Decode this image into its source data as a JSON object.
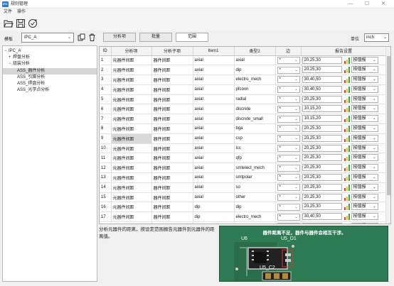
{
  "window": {
    "title": "规则管理",
    "app_icon": "app-icon"
  },
  "menu": [
    "文件",
    "操作"
  ],
  "toolbar": {
    "icons": [
      "open-folder-icon",
      "save-icon",
      "refresh-check-icon"
    ]
  },
  "template": {
    "label": "模板",
    "value": "IPC_A"
  },
  "tree": [
    {
      "label": "IPC_A",
      "toggle": "−",
      "level": 0
    },
    {
      "label": "焊盘分析",
      "toggle": "+",
      "level": 1
    },
    {
      "label": "组装分析",
      "toggle": "−",
      "level": 1
    },
    {
      "label": "ASS_器件分析",
      "toggle": "",
      "level": 2,
      "selected": true
    },
    {
      "label": "ASS_引脚分析",
      "toggle": "",
      "level": 2
    },
    {
      "label": "ASS_焊盘分析",
      "toggle": "",
      "level": 2
    },
    {
      "label": "ASS_光学点分析",
      "toggle": "",
      "level": 2
    }
  ],
  "tabs": [
    "分析项",
    "批量",
    "范围"
  ],
  "unit": {
    "label": "单位",
    "value": "inch"
  },
  "columns": [
    "ID",
    "分析项",
    "分析子项",
    "Item1",
    "类型2",
    "边",
    "报告设置"
  ],
  "rows": [
    {
      "id": "1",
      "item": "元器件间距",
      "sub": "器件间距",
      "item1": "axial",
      "type2": "axial",
      "side": "*",
      "report": "20,25,30",
      "mode": "按值报"
    },
    {
      "id": "2",
      "item": "元器件间距",
      "sub": "器件间距",
      "item1": "axial",
      "type2": "dip",
      "side": "*",
      "report": "20,25,30",
      "mode": "按值报"
    },
    {
      "id": "3",
      "item": "元器件间距",
      "sub": "器件间距",
      "item1": "axial",
      "type2": "electro_mech",
      "side": "*",
      "report": "30,40,50",
      "mode": "按值报"
    },
    {
      "id": "4",
      "item": "元器件间距",
      "sub": "器件间距",
      "item1": "axial",
      "type2": "pfconn",
      "side": "*",
      "report": "30,40,50",
      "mode": "按值报"
    },
    {
      "id": "5",
      "item": "元器件间距",
      "sub": "器件间距",
      "item1": "axial",
      "type2": "radial",
      "side": "*",
      "report": "20,25,30",
      "mode": "按值报"
    },
    {
      "id": "6",
      "item": "元器件间距",
      "sub": "器件间距",
      "item1": "axial",
      "type2": "discrete",
      "side": "*",
      "report": "10,15,20",
      "mode": "按值报"
    },
    {
      "id": "7",
      "item": "元器件间距",
      "sub": "器件间距",
      "item1": "axial",
      "type2": "discrete_small",
      "side": "*",
      "report": "10,15,20",
      "mode": "按值报"
    },
    {
      "id": "8",
      "item": "元器件间距",
      "sub": "器件间距",
      "item1": "axial",
      "type2": "bga",
      "side": "*",
      "report": "20,25,30",
      "mode": "按值报"
    },
    {
      "id": "9",
      "item": "元器件间距",
      "sub": "器件间距",
      "item1": "axial",
      "type2": "csp",
      "side": "*",
      "report": "20,25,30",
      "mode": "按值报",
      "selected": true
    },
    {
      "id": "10",
      "item": "元器件间距",
      "sub": "器件间距",
      "item1": "axial",
      "type2": "lcc",
      "side": "*",
      "report": "20,25,30",
      "mode": "按值报"
    },
    {
      "id": "11",
      "item": "元器件间距",
      "sub": "器件间距",
      "item1": "axial",
      "type2": "qfp",
      "side": "*",
      "report": "20,25,30",
      "mode": "按值报"
    },
    {
      "id": "12",
      "item": "元器件间距",
      "sub": "器件间距",
      "item1": "axial",
      "type2": "smtelect_mech",
      "side": "*",
      "report": "20,25,30",
      "mode": "按值报"
    },
    {
      "id": "13",
      "item": "元器件间距",
      "sub": "器件间距",
      "item1": "axial",
      "type2": "smtpolar",
      "side": "*",
      "report": "20,25,30",
      "mode": "按值报"
    },
    {
      "id": "14",
      "item": "元器件间距",
      "sub": "器件间距",
      "item1": "axial",
      "type2": "so",
      "side": "*",
      "report": "20,25,30",
      "mode": "按值报"
    },
    {
      "id": "15",
      "item": "元器件间距",
      "sub": "器件间距",
      "item1": "axial",
      "type2": "other",
      "side": "*",
      "report": "20,25,30",
      "mode": "按值报"
    },
    {
      "id": "16",
      "item": "元器件间距",
      "sub": "器件间距",
      "item1": "dip",
      "type2": "dip",
      "side": "*",
      "report": "20,25,30",
      "mode": "按值报"
    },
    {
      "id": "17",
      "item": "元器件间距",
      "sub": "器件间距",
      "item1": "dip",
      "type2": "electro_mech",
      "side": "*",
      "report": "30,40,50",
      "mode": "按值报"
    },
    {
      "id": "18",
      "item": "元器件间距",
      "sub": "器件间距",
      "item1": "dip",
      "type2": "pfconn",
      "side": "*",
      "report": "30,40,50",
      "mode": "按值报"
    }
  ],
  "description": "分析元器件的距离，按设定范围报告元器件到元器件的距离值。",
  "preview": {
    "caption": "器件距离不足，器件与器件会相互干涉。",
    "labels": [
      "U6",
      "U5_D1",
      "U5_C2"
    ]
  },
  "colors": {
    "accent": "#2b79d8",
    "pcb_green": "#2e7a52",
    "bar_red": "#e23a2e",
    "bar_yellow": "#f2c12e",
    "bar_green": "#36a84a"
  }
}
